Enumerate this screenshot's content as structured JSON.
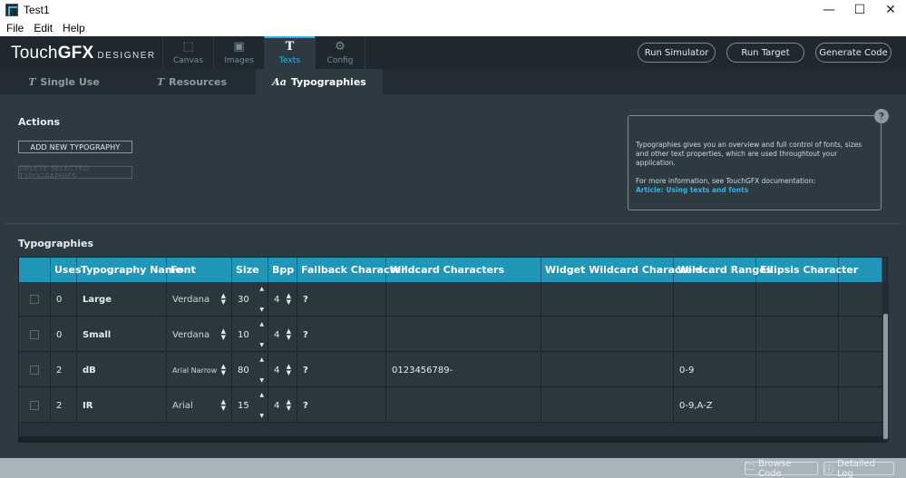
{
  "window": {
    "title": "Test1"
  },
  "menu": [
    "File",
    "Edit",
    "Help"
  ],
  "logo": {
    "brand_a": "Touch",
    "brand_b": "GFX",
    "suffix": "DESIGNER"
  },
  "main_tabs": [
    {
      "label": "Canvas",
      "icon": "canvas-icon"
    },
    {
      "label": "Images",
      "icon": "images-icon"
    },
    {
      "label": "Texts",
      "icon": "texts-icon",
      "active": true
    },
    {
      "label": "Config",
      "icon": "gear-icon"
    }
  ],
  "top_buttons": {
    "run_simulator": "Run Simulator",
    "run_target": "Run Target",
    "generate_code": "Generate Code"
  },
  "sub_tabs": [
    {
      "label": "Single Use",
      "icon_glyph": "T"
    },
    {
      "label": "Resources",
      "icon_glyph": "T"
    },
    {
      "label": "Typographies",
      "icon_glyph": "Aa",
      "active": true
    }
  ],
  "actions": {
    "title": "Actions",
    "add": "ADD NEW TYPOGRAPHY",
    "delete": "DELETE SELECTED TYPOGRAPHIES"
  },
  "info": {
    "line1": "Typographies gives you an overview and full control of fonts, sizes and other text properties, which are used throughtout your application.",
    "line2": "For more information, see TouchGFX documentation:",
    "link": "Article: Using texts and fonts",
    "help_glyph": "?"
  },
  "typographies": {
    "title": "Typographies",
    "columns": [
      "",
      "Uses",
      "Typography Name",
      "Font",
      "Size",
      "Bpp",
      "Fallback Character",
      "Wildcard Characters",
      "Widget Wildcard Characters",
      "Wildcard Ranges",
      "Ellipsis Character",
      ""
    ],
    "rows": [
      {
        "uses": "0",
        "name": "Large",
        "font": "Verdana",
        "size": "30",
        "bpp": "4",
        "fallback": "?",
        "wildcard": "",
        "widget_wildcard": "",
        "ranges": "",
        "ellipsis": ""
      },
      {
        "uses": "0",
        "name": "Small",
        "font": "Verdana",
        "size": "10",
        "bpp": "4",
        "fallback": "?",
        "wildcard": "",
        "widget_wildcard": "",
        "ranges": "",
        "ellipsis": ""
      },
      {
        "uses": "2",
        "name": "dB",
        "font": "Arial Narrow",
        "size": "80",
        "bpp": "4",
        "fallback": "?",
        "wildcard": "0123456789-",
        "widget_wildcard": "",
        "ranges": "0-9",
        "ellipsis": ""
      },
      {
        "uses": "2",
        "name": "IR",
        "font": "Arial",
        "size": "15",
        "bpp": "4",
        "fallback": "?",
        "wildcard": "",
        "widget_wildcard": "",
        "ranges": "0-9,A-Z",
        "ellipsis": ""
      }
    ]
  },
  "bottom": {
    "browse_code": "Browse Code",
    "detailed_log": "Detailed Log"
  },
  "colors": {
    "accent": "#2fb5e3",
    "header": "#2196b8",
    "background": "#2e3a42"
  }
}
